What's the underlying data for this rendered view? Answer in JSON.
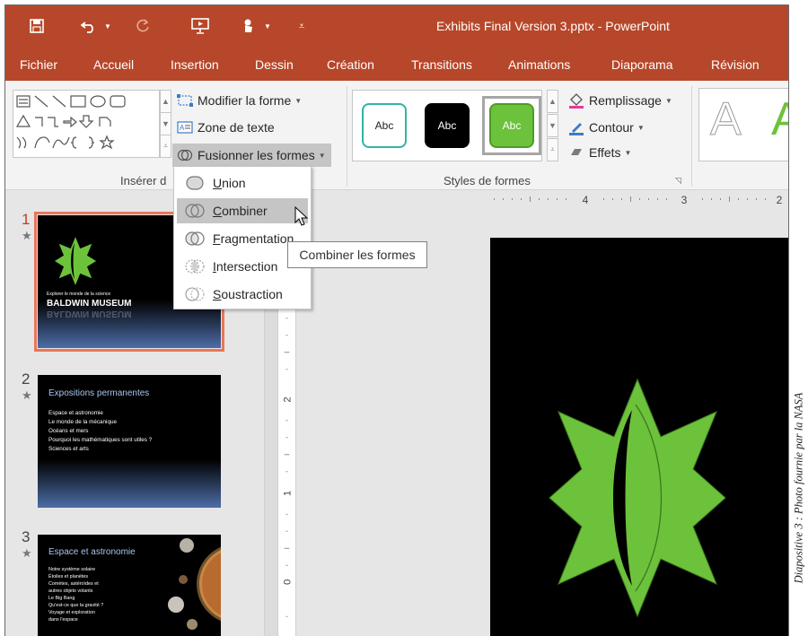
{
  "window": {
    "title": "Exhibits Final Version 3.pptx - PowerPoint"
  },
  "qat": {
    "icons": [
      "save-icon",
      "undo-icon",
      "redo-icon",
      "slideshow-icon",
      "touch-mode-icon",
      "customize-qat-icon"
    ]
  },
  "tabs": [
    "Fichier",
    "Accueil",
    "Insertion",
    "Dessin",
    "Création",
    "Transitions",
    "Animations",
    "Diaporama",
    "Révision"
  ],
  "ribbon": {
    "insert_shapes": {
      "label": "Insérer d",
      "modify_shape": "Modifier la forme",
      "text_box": "Zone de texte",
      "merge_shapes": "Fusionner les formes"
    },
    "shape_styles": {
      "label": "Styles de formes",
      "samples": [
        "Abc",
        "Abc",
        "Abc"
      ],
      "fill": "Remplissage",
      "outline": "Contour",
      "effects": "Effets"
    },
    "wordart": {
      "sample": "A"
    }
  },
  "merge_menu": {
    "items": [
      {
        "label": "Union",
        "mnemonic": "U",
        "rest": "nion"
      },
      {
        "label": "Combiner",
        "mnemonic": "C",
        "rest": "ombiner"
      },
      {
        "label": "Fragmentation",
        "mnemonic": "F",
        "rest": "ragmentation"
      },
      {
        "label": "Intersection",
        "mnemonic": "I",
        "rest": "ntersection"
      },
      {
        "label": "Soustraction",
        "mnemonic": "S",
        "rest": "oustraction"
      }
    ],
    "highlighted": "Combiner",
    "tooltip": "Combiner les formes"
  },
  "ruler": {
    "horizontal_labels": [
      "4",
      "3",
      "2"
    ],
    "vertical_labels": [
      "2",
      "1",
      "0"
    ]
  },
  "slides": [
    {
      "number": "1",
      "subtitle": "Explorer le monde de la science",
      "title": "BALDWIN MUSEUM",
      "selected": true
    },
    {
      "number": "2",
      "title": "Expositions permanentes",
      "bullets": [
        "Espace et astronomie",
        "Le monde de la mécanique",
        "Océans et mers",
        "Pourquoi les mathématiques sont utiles ?",
        "Sciences et arts"
      ]
    },
    {
      "number": "3",
      "title": "Espace et astronomie",
      "bullets": [
        "Notre système solaire",
        "Étoiles et planètes",
        "Comètes, astéroïdes et",
        "autres objets volants",
        "Le Big Bang",
        "Qu'est-ce que la gravité ?",
        "Voyage et exploration",
        "dans l'espace"
      ]
    }
  ],
  "colors": {
    "accent": "#b7472a",
    "shape_green": "#6dc23b",
    "selection": "#e8765a"
  },
  "caption": "Diapositive 3 : Photo fournie par la NASA"
}
